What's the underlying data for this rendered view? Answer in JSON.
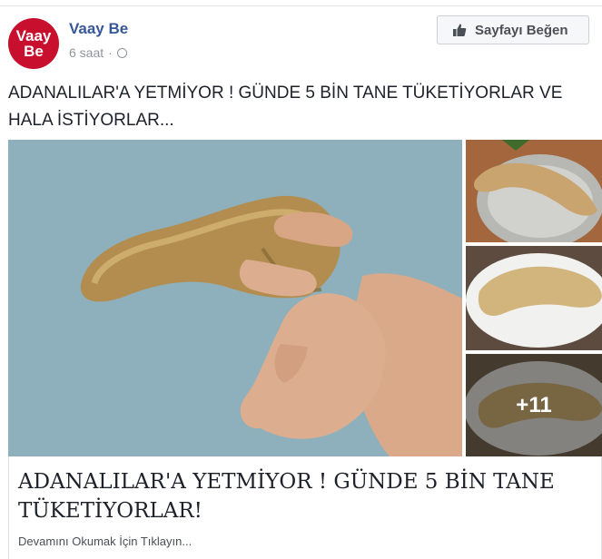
{
  "post": {
    "avatar_line1": "Vaay",
    "avatar_line2": "Be",
    "page_name": "Vaay Be",
    "time": "6 saat",
    "separator": "·",
    "like_button": "Sayfayı Beğen",
    "text": "ADANALILAR'A YETMİYOR ! GÜNDE 5 BİN TANE TÜKETİYORLAR VE HALA İSTİYORLAR..."
  },
  "media": {
    "more_count": "+11"
  },
  "link": {
    "title": "ADANALILAR'A YETMİYOR ! GÜNDE 5 BİN TANE TÜKETİYORLAR!",
    "subtitle": "Devamını Okumak İçin Tıklayın..."
  },
  "colors": {
    "brand_red": "#c8102e",
    "link_blue": "#365899",
    "meta_gray": "#90949c"
  }
}
